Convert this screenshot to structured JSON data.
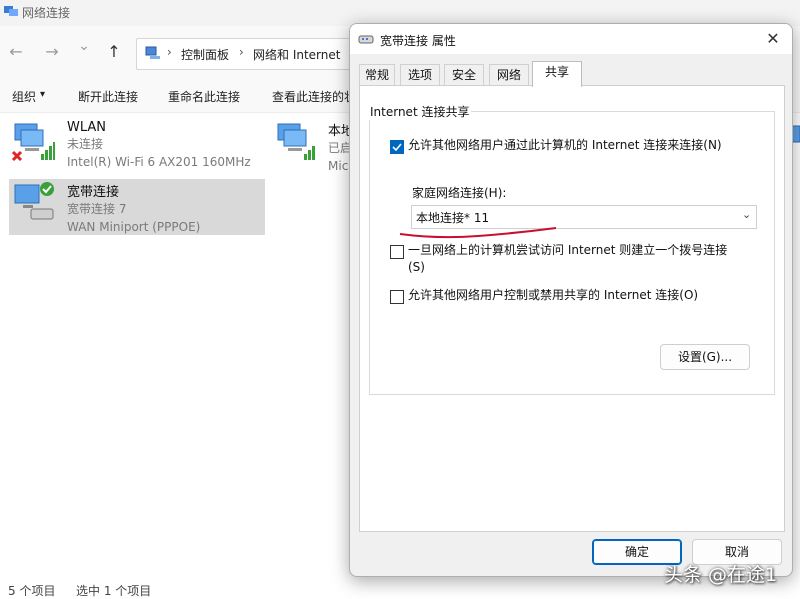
{
  "window": {
    "title": "网络连接"
  },
  "nav": {
    "back": "←",
    "forward": "→",
    "dropdown": "⌄",
    "up": "↑"
  },
  "address": {
    "sep1": "›",
    "crumb1": "控制面板",
    "sep2": "›",
    "crumb2": "网络和 Internet"
  },
  "toolbar": {
    "organize": "组织",
    "organize_arrow": "▾",
    "disconnect": "断开此连接",
    "rename": "重命名此连接",
    "view_status": "查看此连接的状"
  },
  "connections": [
    {
      "name": "WLAN",
      "status": "未连接",
      "device": "Intel(R) Wi-Fi 6 AX201 160MHz"
    },
    {
      "name": "宽带连接",
      "status": "宽带连接 7",
      "device": "WAN Miniport (PPPOE)"
    },
    {
      "name": "本地",
      "status": "已启",
      "device": "Mic"
    }
  ],
  "statusbar": {
    "count": "5 个项目",
    "selected": "选中 1 个项目"
  },
  "dialog": {
    "title": "宽带连接 属性",
    "close": "✕",
    "tabs": [
      "常规",
      "选项",
      "安全",
      "网络",
      "共享"
    ],
    "group_title": "Internet 连接共享",
    "allow_share_label": "允许其他网络用户通过此计算机的 Internet 连接来连接(N)",
    "home_network_label": "家庭网络连接(H):",
    "home_network_value": "本地连接* 11",
    "home_network_chevron": "⌄",
    "dialup_label_line1": "一旦网络上的计算机尝试访问 Internet 则建立一个拨号连接",
    "dialup_label_line2": "(S)",
    "allow_control_label": "允许其他网络用户控制或禁用共享的 Internet 连接(O)",
    "settings_button": "设置(G)...",
    "ok_button": "确定",
    "cancel_button": "取消"
  },
  "watermark": "头条 @在途1",
  "colors": {
    "accent": "#0067c0",
    "annotation": "#c8102e",
    "selection": "#d9d9d9"
  }
}
